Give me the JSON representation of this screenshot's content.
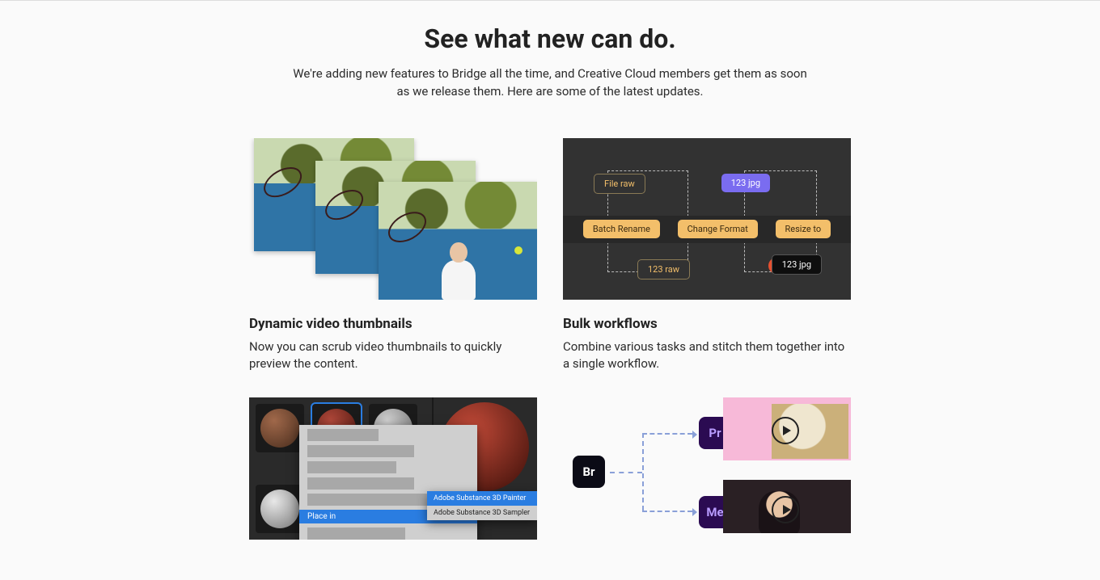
{
  "hero": {
    "title": "See what new can do.",
    "subtitle": "We're adding new features to Bridge all the time, and Creative Cloud members get them as soon as we release them. Here are some of the latest updates."
  },
  "features": [
    {
      "title": "Dynamic video thumbnails",
      "body": "Now you can scrub video thumbnails to quickly preview the content."
    },
    {
      "title": "Bulk workflows",
      "body": "Combine various tasks and stitch them together into a single workflow.",
      "diagram": {
        "file_raw": "File raw",
        "num_jpg": "123 jpg",
        "batch_rename": "Batch Rename",
        "change_format": "Change Format",
        "resize_to": "Resize to",
        "num_raw": "123 raw",
        "out_jpg": "123 jpg"
      }
    },
    {
      "title": "",
      "body": "",
      "substance": {
        "place_in": "Place in",
        "fly_hl": "Adobe Substance 3D Painter",
        "fly_row": "Adobe Substance 3D Sampler"
      }
    },
    {
      "title": "",
      "body": "",
      "apps": {
        "br": "Br",
        "pr": "Pr",
        "me": "Me"
      }
    }
  ]
}
